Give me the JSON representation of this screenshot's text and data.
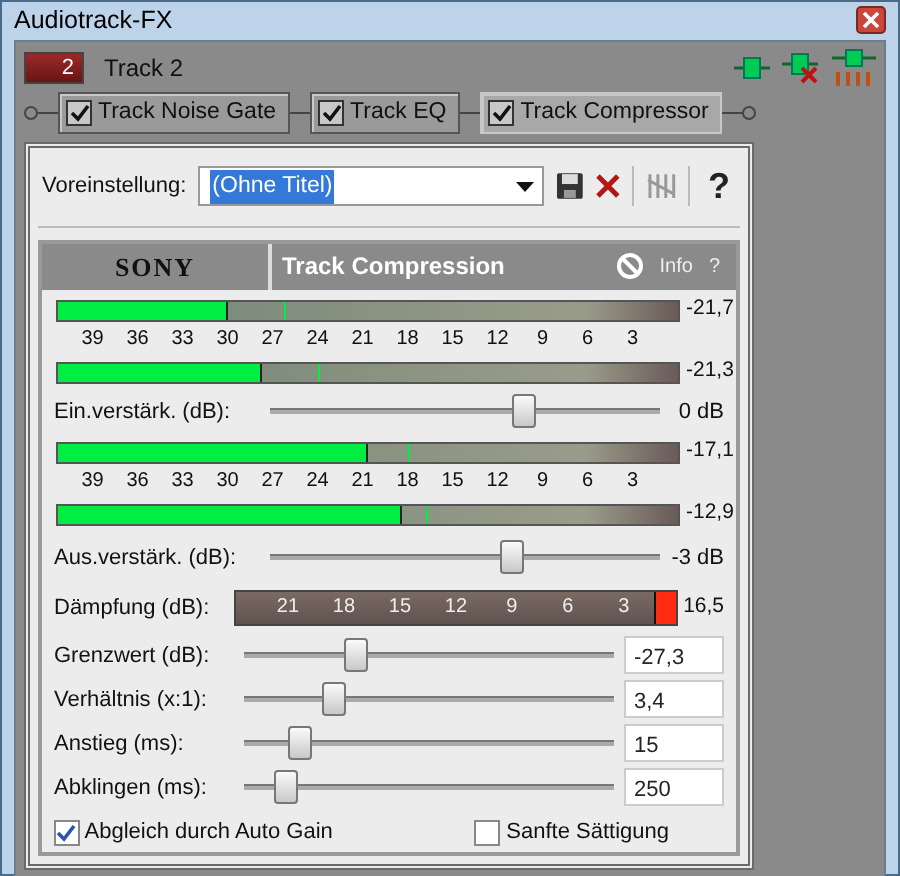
{
  "window": {
    "title": "Audiotrack-FX"
  },
  "track": {
    "number": "2",
    "name": "Track 2"
  },
  "chain": [
    {
      "label": "Track Noise Gate",
      "checked": true,
      "selected": false
    },
    {
      "label": "Track EQ",
      "checked": true,
      "selected": false
    },
    {
      "label": "Track Compressor",
      "checked": true,
      "selected": true
    }
  ],
  "preset": {
    "label": "Voreinstellung:",
    "value": "(Ohne Titel)",
    "help": "?"
  },
  "plugin": {
    "brand": "SONY",
    "title": "Track Compression",
    "info": "Info",
    "help": "?"
  },
  "input_meters": {
    "meters": [
      {
        "level": 0.275,
        "peak": {
          "level": 0.365
        },
        "reading": "-21,7"
      },
      {
        "level": 0.33,
        "peak": {
          "level": 0.42
        },
        "reading": "-21,3"
      }
    ],
    "scale": [
      "39",
      "36",
      "33",
      "30",
      "27",
      "24",
      "21",
      "18",
      "15",
      "12",
      "9",
      "6",
      "3"
    ]
  },
  "input_gain": {
    "label": "Ein.verstärk. (dB):",
    "level": 0.65,
    "reading": "0 dB"
  },
  "output_meters": {
    "meters": [
      {
        "level": 0.5,
        "peak": {
          "level": 0.565
        },
        "reading": "-17,1"
      },
      {
        "level": 0.555,
        "peak": {
          "level": 0.595
        },
        "reading": "-12,9"
      }
    ],
    "scale": [
      "39",
      "36",
      "33",
      "30",
      "27",
      "24",
      "21",
      "18",
      "15",
      "12",
      "9",
      "6",
      "3"
    ]
  },
  "output_gain": {
    "label": "Aus.verstärk. (dB):",
    "level": 0.62,
    "reading": "-3 dB"
  },
  "attenuation": {
    "label": "Dämpfung (dB):",
    "level": 0.05,
    "scale": [
      "21",
      "18",
      "15",
      "12",
      "9",
      "6",
      "3"
    ],
    "reading": "16,5"
  },
  "params": [
    {
      "label": "Grenzwert (dB):",
      "level": 0.3,
      "value": "-27,3"
    },
    {
      "label": "Verhältnis (x:1):",
      "level": 0.245,
      "value": "3,4"
    },
    {
      "label": "Anstieg (ms):",
      "level": 0.15,
      "value": "15"
    },
    {
      "label": "Abklingen (ms):",
      "level": 0.115,
      "value": "250"
    }
  ],
  "options": [
    {
      "label": "Abgleich durch Auto Gain",
      "checked": true
    },
    {
      "label": "Sanfte Sättigung",
      "checked": false
    }
  ]
}
